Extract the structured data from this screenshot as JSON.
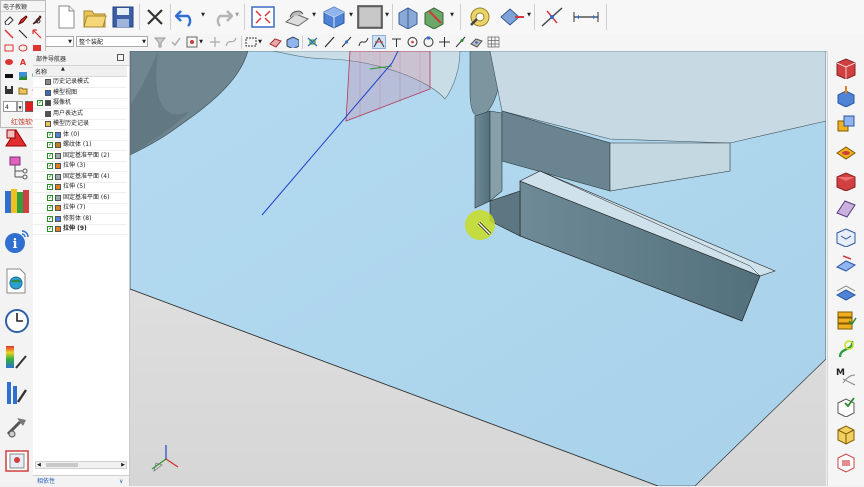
{
  "floating_panel": {
    "title": "电子教鞭",
    "brand": "红蚀软件",
    "line_width": "4"
  },
  "toolbar2": {
    "filter_select": "",
    "assembly_select": "整个装配"
  },
  "navigator": {
    "title": "部件导航器",
    "column_header": "名称",
    "rows": [
      {
        "label": "历史记录模式",
        "checked": false,
        "indent": 1,
        "icon": "history-icon"
      },
      {
        "label": "模型视图",
        "checked": false,
        "indent": 1,
        "icon": "view-icon"
      },
      {
        "label": "摄像机",
        "checked": true,
        "indent": 1,
        "icon": "camera-icon"
      },
      {
        "label": "用户表达式",
        "checked": false,
        "indent": 1,
        "icon": "expression-icon"
      },
      {
        "label": "模型历史记录",
        "checked": false,
        "indent": 1,
        "icon": "folder-icon"
      },
      {
        "label": "体 (0)",
        "checked": true,
        "indent": 2,
        "icon": "body-icon"
      },
      {
        "label": "螺纹体 (1)",
        "checked": true,
        "indent": 2,
        "icon": "thread-icon"
      },
      {
        "label": "固定基准平面 (2)",
        "checked": true,
        "indent": 2,
        "icon": "datum-plane-icon"
      },
      {
        "label": "拉伸 (3)",
        "checked": true,
        "indent": 2,
        "icon": "extrude-icon"
      },
      {
        "label": "固定基准平面 (4)",
        "checked": true,
        "indent": 2,
        "icon": "datum-plane-icon"
      },
      {
        "label": "拉伸 (5)",
        "checked": true,
        "indent": 2,
        "icon": "extrude-icon"
      },
      {
        "label": "固定基准平面 (6)",
        "checked": true,
        "indent": 2,
        "icon": "datum-plane-icon"
      },
      {
        "label": "拉伸 (7)",
        "checked": true,
        "indent": 2,
        "icon": "extrude-icon"
      },
      {
        "label": "修剪体 (8)",
        "checked": true,
        "indent": 2,
        "icon": "trim-body-icon"
      },
      {
        "label": "拉伸 (9)",
        "checked": true,
        "indent": 2,
        "icon": "extrude-icon",
        "bold": true
      }
    ],
    "footer": "相依性"
  },
  "colors": {
    "floor": "#acd5ec",
    "part_dark": "#5d7883",
    "part_light": "#c9dde6",
    "highlight_cursor": "#c8dc22",
    "datum_plane": "#d34a72",
    "axis_blue": "#2244cc"
  }
}
